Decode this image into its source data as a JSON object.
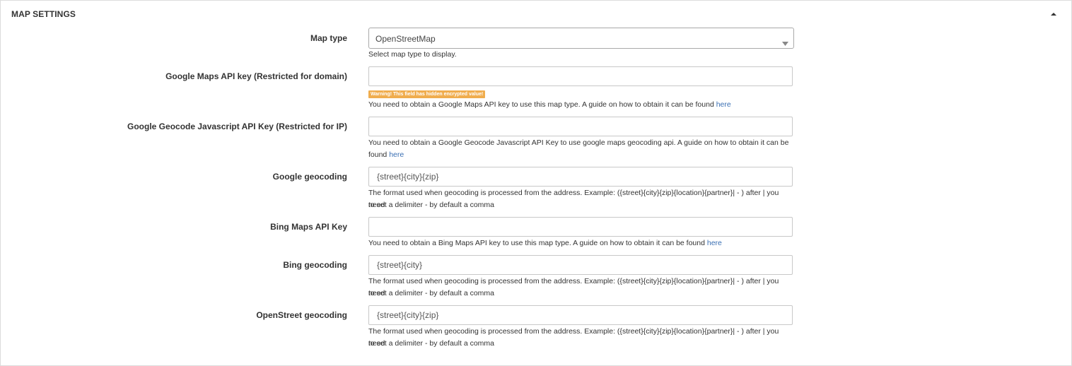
{
  "panel": {
    "title": "MAP SETTINGS",
    "collapse_icon": "caret-up-icon"
  },
  "map_type": {
    "label": "Map type",
    "selected": "OpenStreetMap",
    "help": "Select map type to display."
  },
  "google_maps_key": {
    "label": "Google Maps API key (Restricted for domain)",
    "value": "",
    "warning": "Warning! This field has hidden encrypted value!",
    "help": "You need to obtain a Google Maps API key to use this map type. A guide on how to obtain it can be found",
    "link": "here"
  },
  "google_geocode_key": {
    "label": "Google Geocode Javascript API Key (Restricted for IP)",
    "value": "",
    "help_line1": "You need to obtain a Google Geocode Javascript API Key to use google maps geocoding api. A guide on how to obtain it can be",
    "help_line2": "found",
    "link": "here"
  },
  "google_geocoding": {
    "label": "Google geocoding",
    "value": "{street}{city}{zip}",
    "help_line1": "The format used when geocoding is processed from the address. Example: ({street}{city}{zip}{location}{partner}| - ) after | you need",
    "help_line2": "to set a delimiter - by default a comma"
  },
  "bing_maps_key": {
    "label": "Bing Maps API Key",
    "value": "",
    "help": "You need to obtain a Bing Maps API key to use this map type. A guide on how to obtain it can be found",
    "link": "here"
  },
  "bing_geocoding": {
    "label": "Bing geocoding",
    "value": "{street}{city}",
    "help_line1": "The format used when geocoding is processed from the address. Example: ({street}{city}{zip}{location}{partner}| - ) after | you need",
    "help_line2": "to set a delimiter - by default a comma"
  },
  "openstreet_geocoding": {
    "label": "OpenStreet geocoding",
    "value": "{street}{city}{zip}",
    "help_line1": "The format used when geocoding is processed from the address. Example: ({street}{city}{zip}{location}{partner}| - ) after | you need",
    "help_line2": "to set a delimiter - by default a comma"
  },
  "colors": {
    "link": "#3a6fb3",
    "warning": "#f0ad4e",
    "border": "#c8c8c8"
  }
}
